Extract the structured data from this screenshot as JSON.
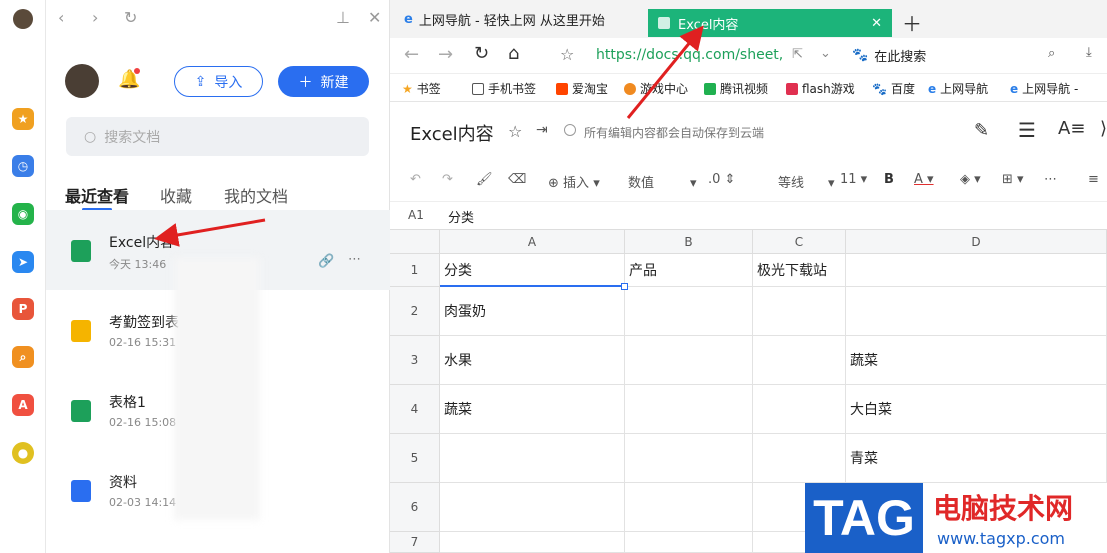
{
  "sidebar": {
    "import_label": "导入",
    "new_label": "新建",
    "search_placeholder": "搜索文档",
    "tabs": [
      "最近查看",
      "收藏",
      "我的文档"
    ],
    "files": [
      {
        "name": "Excel内容",
        "date": "今天 13:46",
        "color": "#1da05a"
      },
      {
        "name": "考勤签到表",
        "date": "02-16 15:31",
        "color": "#f5b400"
      },
      {
        "name": "表格1",
        "date": "02-16 15:08",
        "color": "#1da05a"
      },
      {
        "name": "资料",
        "date": "02-03 14:14",
        "color": "#2a6ef0"
      }
    ]
  },
  "browser": {
    "tabs": [
      "上网导航 - 轻快上网 从这里开始",
      "Excel内容"
    ],
    "url": "https://docs.qq.com/sheet,",
    "search_label": "在此搜索",
    "bookmarks": [
      "书签",
      "手机书签",
      "爱淘宝",
      "游戏中心",
      "腾讯视频",
      "flash游戏",
      "百度",
      "上网导航",
      "上网导航 -"
    ]
  },
  "doc": {
    "title": "Excel内容",
    "save_status": "所有编辑内容都会自动保存到云端",
    "toolbar": {
      "insert": "插入",
      "format": "数值",
      "decimal": ".0",
      "font": "等线",
      "size": "11",
      "bold": "B"
    },
    "cell_ref": "A1",
    "formula_value": "分类",
    "columns": [
      "A",
      "B",
      "C",
      "D"
    ],
    "rows": [
      "1",
      "2",
      "3",
      "4",
      "5",
      "6",
      "7"
    ],
    "cells": {
      "A1": "分类",
      "B1": "产品",
      "C1": "极光下载站",
      "A2": "肉蛋奶",
      "A3": "水果",
      "D3": "蔬菜",
      "A4": "蔬菜",
      "D4": "大白菜",
      "D5": "青菜"
    }
  },
  "watermark": {
    "tag": "TAG",
    "cn": "电脑技术网",
    "url": "www.tagxp.com"
  }
}
